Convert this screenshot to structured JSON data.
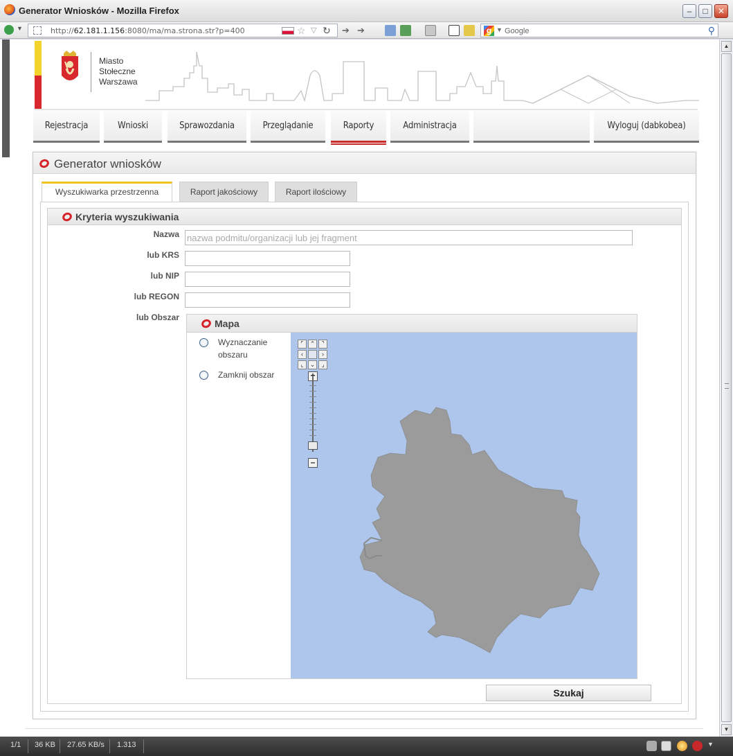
{
  "window": {
    "title": "Generator Wniosków - Mozilla Firefox",
    "url_prefix": "http://",
    "url_host": "62.181.1.156",
    "url_rest": ":8080/ma/ma.strona.str?p=400",
    "search_placeholder": "Google"
  },
  "header": {
    "city_name_1": "Miasto",
    "city_name_2": "Stołeczne",
    "city_name_3": "Warszawa"
  },
  "nav": {
    "items": [
      {
        "label": "Rejestracja"
      },
      {
        "label": "Wnioski"
      },
      {
        "label": "Sprawozdania"
      },
      {
        "label": "Przeglądanie"
      },
      {
        "label": "Raporty"
      },
      {
        "label": "Administracja"
      },
      {
        "label": ""
      },
      {
        "label": "Wyloguj (dabkobea)"
      }
    ],
    "active": "Raporty"
  },
  "panel": {
    "title": "Generator wniosków",
    "tabs": [
      {
        "label": "Wyszukiwarka przestrzenna"
      },
      {
        "label": "Raport jakościowy"
      },
      {
        "label": "Raport ilościowy"
      }
    ]
  },
  "criteria": {
    "title": "Kryteria wyszukiwania",
    "name_label": "Nazwa",
    "name_placeholder": "nazwa podmitu/organizacji lub jej fragment",
    "krs_label": "lub KRS",
    "nip_label": "lub NIP",
    "regon_label": "lub REGON",
    "area_label": "lub Obszar"
  },
  "map": {
    "title": "Mapa",
    "option_define_1": "Wyznaczanie",
    "option_define_2": "obszaru",
    "option_close": "Zamknij obszar",
    "water_color": "#aec6ec",
    "land_color": "#9b9b9b"
  },
  "actions": {
    "search_label": "Szukaj"
  },
  "status": {
    "page": "1/1",
    "size": "36 KB",
    "speed": "27.65 KB/s",
    "time": "1.313"
  }
}
